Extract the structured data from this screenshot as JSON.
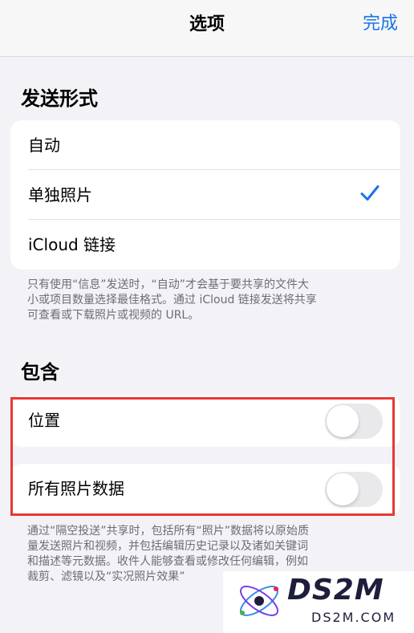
{
  "nav": {
    "title": "选项",
    "done_label": "完成"
  },
  "send_format": {
    "header": "发送形式",
    "options": [
      {
        "label": "自动",
        "selected": false
      },
      {
        "label": "单独照片",
        "selected": true
      },
      {
        "label": "iCloud 链接",
        "selected": false
      }
    ],
    "footer_lines": [
      "只有使用“信息”发送时，“自动”才会基于要共享的文件大",
      "小或项目数量选择最佳格式。通过 iCloud 链接发送将共享",
      "可查看或下载照片或视频的 URL。"
    ]
  },
  "include": {
    "header": "包含",
    "location": {
      "label": "位置",
      "on": false
    },
    "all_photos_data": {
      "label": "所有照片数据",
      "on": false
    },
    "footer_lines": [
      "通过“隔空投送”共享时，包括所有“照片”数据将以原始质",
      "量发送照片和视频，并包括编辑历史记录以及诸如关键词",
      "和描述等元数据。收件人能够查看或修改任何编辑，例如",
      "裁剪、滤镜以及“实况照片效果”"
    ]
  },
  "watermark": {
    "text": "DS2M",
    "sub": "DS2M.COM"
  },
  "colors": {
    "accent": "#1a73e8",
    "highlight": "#e53935",
    "toggle_off": "#e9e9eb"
  }
}
